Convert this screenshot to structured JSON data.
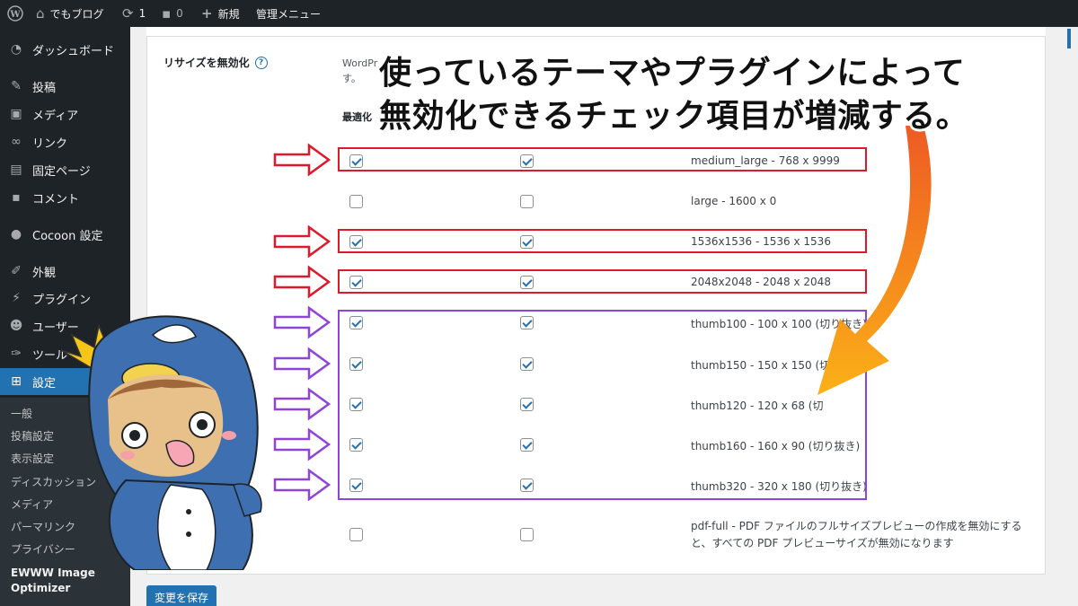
{
  "admin_bar": {
    "site_name": "でもブログ",
    "updates_count": "1",
    "comments_count": "0",
    "new_label": "新規",
    "admin_menu_label": "管理メニュー"
  },
  "sidebar": {
    "items": [
      {
        "label": "ダッシュボード",
        "icon": "dashboard-icon"
      },
      {
        "label": "投稿",
        "icon": "pin-icon"
      },
      {
        "label": "メディア",
        "icon": "media-icon"
      },
      {
        "label": "リンク",
        "icon": "link-icon"
      },
      {
        "label": "固定ページ",
        "icon": "page-icon"
      },
      {
        "label": "コメント",
        "icon": "comment-icon"
      },
      {
        "label": "Cocoon 設定",
        "icon": "circle-icon"
      },
      {
        "label": "外観",
        "icon": "brush-icon"
      },
      {
        "label": "プラグイン",
        "icon": "plugin-icon"
      },
      {
        "label": "ユーザー",
        "icon": "user-icon"
      },
      {
        "label": "ツール",
        "icon": "wrench-icon"
      },
      {
        "label": "設定",
        "icon": "settings-icon"
      }
    ],
    "submenu": [
      "一般",
      "投稿設定",
      "表示設定",
      "ディスカッション",
      "メディア",
      "パーマリンク",
      "プライバシー"
    ],
    "ewww_line1": "EWWW Image",
    "ewww_line2": "Optimizer"
  },
  "settings": {
    "field_label": "リサイズを無効化",
    "help_glyph": "?",
    "description_fragment": "WordPr",
    "description_line2": "す。",
    "column_heading": "最適化",
    "rows": [
      {
        "label": "medium_large - 768 x 9999",
        "checked": true
      },
      {
        "label": "large - 1600 x 0",
        "checked": false
      },
      {
        "label": "1536x1536 - 1536 x 1536",
        "checked": true
      },
      {
        "label": "2048x2048 - 2048 x 2048",
        "checked": true
      },
      {
        "label": "thumb100 - 100 x 100 (切り抜き)",
        "checked": true
      },
      {
        "label": "thumb150 - 150 x 150 (切",
        "checked": true
      },
      {
        "label": "thumb120 - 120 x 68 (切",
        "checked": true
      },
      {
        "label": "thumb160 - 160 x 90 (切り抜き)",
        "checked": true
      },
      {
        "label": "thumb320 - 320 x 180 (切り抜き)",
        "checked": true
      },
      {
        "label": "pdf-full - PDF ファイルのフルサイズプレビューの作成を無効にすると、すべての PDF プレビューサイズが無効になります",
        "checked": false
      }
    ],
    "save_label": "変更を保存"
  },
  "caption": {
    "line1": "使っているテーマやプラグインによって",
    "line2": "無効化できるチェック項目が増減する。"
  },
  "colors": {
    "highlight_red": "#e0182d",
    "highlight_purple": "#8e44d8",
    "big_arrow": "#f28a1c"
  }
}
